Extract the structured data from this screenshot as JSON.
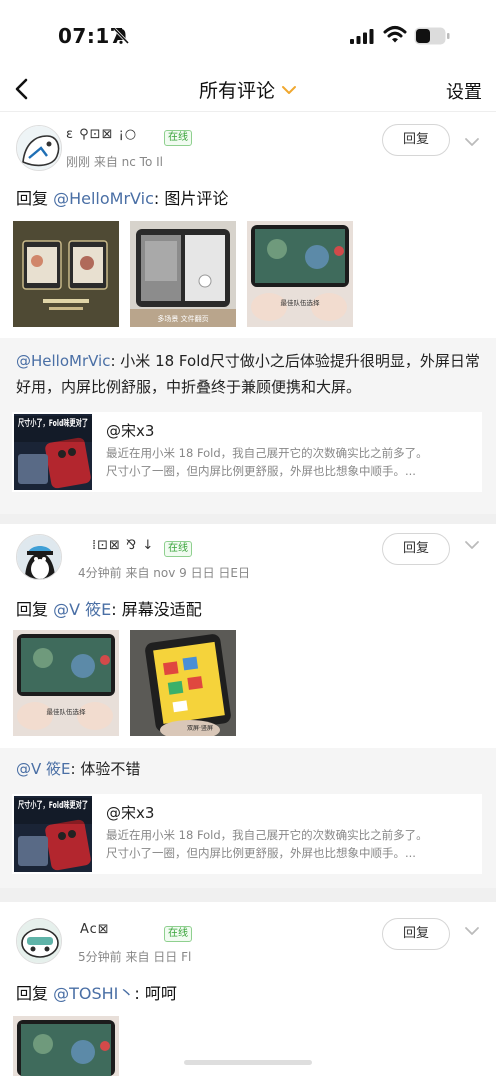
{
  "status_bar": {
    "time": "07:17"
  },
  "nav": {
    "title": "所有评论",
    "settings": "设置"
  },
  "comments": [
    {
      "username": "ε ⚲⊡⊠ ¡○",
      "online": "在线",
      "meta": "刚刚  来自 nc   To Il",
      "reply_button": "回复",
      "reply_prefix": "回复 ",
      "reply_mention": "@HelloMrVic",
      "reply_body": ": 图片评论",
      "quote": {
        "mention": "@HelloMrVic",
        "text": ": 小米 18 Fold尺寸做小之后体验提升很明显，外屏日常好用，内屏比例舒服，中折叠终于兼顾便携和大屏。"
      },
      "card": {
        "author": "@宋x3",
        "line1": "最近在用小米 18 Fold，我自己展开它的次数确实比之前多了。",
        "line2": "尺寸小了一圈，但内屏比例更舒服，外屏也比想象中顺手。...",
        "img_caption": "尺寸小了，Fold味更对了"
      }
    },
    {
      "username": "⁞⊡⊠ ⅋ ↓",
      "online": "在线",
      "meta": "4分钟前  来自 nov   9   日日 日E日",
      "reply_button": "回复",
      "reply_prefix": "回复 ",
      "reply_mention": "@V 筱E",
      "reply_body": ": 屏幕没适配",
      "quote": {
        "mention": "@V 筱E",
        "text": ": 体验不错"
      },
      "card": {
        "author": "@宋x3",
        "line1": "最近在用小米 18 Fold，我自己展开它的次数确实比之前多了。",
        "line2": "尺寸小了一圈，但内屏比例更舒服，外屏也比想象中顺手。...",
        "img_caption": "尺寸小了，Fold味更对了"
      }
    },
    {
      "username": "Ac⊠",
      "online": "在线",
      "meta": "5分钟前  来自 日日   Fl",
      "reply_button": "回复",
      "reply_prefix": "回复 ",
      "reply_mention": "@TOSHI丶",
      "reply_body": ": 呵呵"
    }
  ],
  "thumb_captions": {
    "game": "最佳队伍选择",
    "paper": "多场景 文件翻页",
    "fold": "双屏·竖屏"
  },
  "colors": {
    "link": "#4a6fa5",
    "online": "#39a43a",
    "accent": "#f0a830",
    "quote_bg": "#f5f5f5"
  },
  "icons": [
    "bell-off-icon",
    "signal-icon",
    "wifi-icon",
    "battery-icon",
    "back-icon",
    "chevron-down-icon"
  ]
}
